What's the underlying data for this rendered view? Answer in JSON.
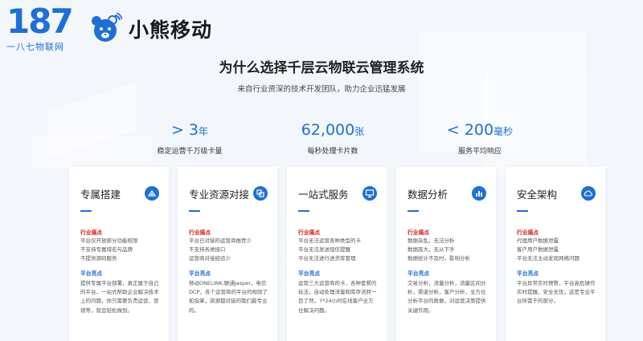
{
  "brand": {
    "logo_number": "187",
    "logo_subtitle": "一八七物联网",
    "bear_name": "小熊移动"
  },
  "header": {
    "title": "为什么选择千层云物联云管理系统",
    "subtitle": "来自行业资深的技术开发团队，助力企业迅猛发展"
  },
  "stats": [
    {
      "prefix": "> ",
      "number": "3",
      "unit": "年",
      "label": "稳定运营千万级卡量"
    },
    {
      "prefix": "",
      "number": "62,000",
      "unit": "张",
      "label": "每秒处理卡片数"
    },
    {
      "prefix": "< ",
      "number": "200",
      "unit": "毫秒",
      "label": "服务平均响应"
    }
  ],
  "cards": [
    {
      "title": "专属搭建",
      "icon": "build-icon",
      "pain_label": "行业痛点",
      "pain_lines": [
        "平台仅开放部分功能权限",
        "不支持专属域名与品牌",
        "不提供源码服务"
      ],
      "highlight_label": "平台亮点",
      "highlight_text": "提供专属平台部署，真正属于自己的平台，一站式帮助企业解决技术上的问题，你只需要负责运营、营销等，就会轻松做到。"
    },
    {
      "title": "专业资源对接",
      "icon": "link-icon",
      "pain_label": "行业痛点",
      "pain_lines": [
        "平台已对接的运营商推荐少",
        "不支持各类接口",
        "运营商对接经验少"
      ],
      "highlight_label": "平台亮点",
      "highlight_text": "移动ONELINK,联通Jasper，电信DCP，各个运营商的平台的规则了如指掌，资源都对接的我们最专业的。"
    },
    {
      "title": "一站式服务",
      "icon": "monitor-icon",
      "pain_label": "行业痛点",
      "pain_lines": [
        "平台无法运营各种类型的卡",
        "平台无法发送短信提醒",
        "平台无法进行进货库管理"
      ],
      "highlight_label": "平台亮点",
      "highlight_text": "运营三大运营商的卡，各种套餐的玩法，自动处理流量和库存流转一目了然，7*24小时在线客户全方位解决问题。"
    },
    {
      "title": "数据分析",
      "icon": "chart-icon",
      "pain_label": "行业痛点",
      "pain_lines": [
        "数据杂乱，无法分析",
        "数据庞大，无从下手",
        "数据统计不及时，影响分析"
      ],
      "highlight_label": "平台亮点",
      "highlight_text": "交易分析，流量分析，流量区间分析，渠道分析，客户分析，全方位分析平台的数据，对运营决策提供关键作用。"
    },
    {
      "title": "安全架构",
      "icon": "cloud-icon",
      "pain_label": "行业痛点",
      "pain_lines": [
        "代理用户数据泄露",
        "客户用户数据泄露",
        "平台无法主动发现网络问题"
      ],
      "highlight_label": "平台亮点",
      "highlight_text": "平台异常实时预警，平台高危操作实时提醒，安全无忧，这是专业平台所需于的部分。"
    }
  ],
  "colors": {
    "accent": "#1e6fd9",
    "pain": "#e02020",
    "background": "#f3f6fb"
  }
}
